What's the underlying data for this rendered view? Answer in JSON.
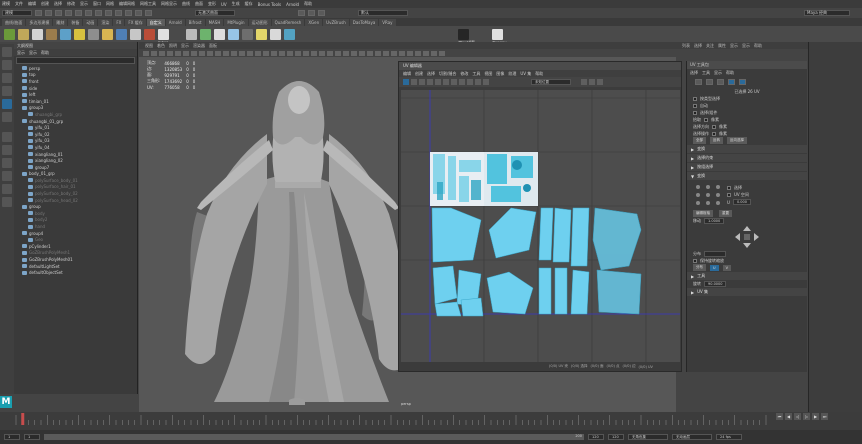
{
  "menubar": {
    "items": [
      "建模",
      "文件",
      "编辑",
      "创建",
      "选择",
      "修改",
      "显示",
      "窗口",
      "网格",
      "编辑网格",
      "网格工具",
      "网格显示",
      "曲线",
      "曲面",
      "变形",
      "UV",
      "生成",
      "缓存",
      "Bonus Tools",
      "Arnold",
      "帮助"
    ],
    "right_label": "Maya 经典"
  },
  "status": {
    "mode": "建模",
    "snap_field": "无激活曲面",
    "render_select": "默认"
  },
  "shelf_tabs": [
    "曲线/曲面",
    "多边形建模",
    "雕刻",
    "装备",
    "动画",
    "渲染",
    "FX",
    "FX 缓存",
    "自定义",
    "Arnold",
    "Bifrost",
    "MASH",
    "MtPlugin",
    "运动图形",
    "QuadRemesh",
    "XGen",
    "UvZBrush",
    "DasToMaya",
    "VRay"
  ],
  "shelf_active_tab": "自定义",
  "shelf_labels": {
    "a": "Uvtool",
    "b": "ZBrush模型",
    "c": "ShaderAttributes",
    "d": "Zhangrou"
  },
  "outliner": {
    "title": "大纲视图",
    "menus": [
      "显示",
      "显示",
      "帮助"
    ],
    "rows": [
      {
        "label": "persp",
        "dim": false,
        "indent": 1
      },
      {
        "label": "top",
        "dim": false,
        "indent": 1
      },
      {
        "label": "front",
        "dim": false,
        "indent": 1
      },
      {
        "label": "side",
        "dim": false,
        "indent": 1
      },
      {
        "label": "left",
        "dim": false,
        "indent": 1
      },
      {
        "label": "timian_01",
        "dim": false,
        "indent": 1
      },
      {
        "label": "group3",
        "dim": false,
        "indent": 1
      },
      {
        "label": "shuangbi_grp",
        "dim": true,
        "indent": 2
      },
      {
        "label": "shuangbi_01_grp",
        "dim": false,
        "indent": 1
      },
      {
        "label": "yifu_01",
        "dim": false,
        "indent": 2
      },
      {
        "label": "yifu_02",
        "dim": false,
        "indent": 2
      },
      {
        "label": "yifu_03",
        "dim": false,
        "indent": 2
      },
      {
        "label": "yifu_04",
        "dim": false,
        "indent": 2
      },
      {
        "label": "xiangliang_01",
        "dim": false,
        "indent": 2
      },
      {
        "label": "xiangliang_02",
        "dim": false,
        "indent": 2
      },
      {
        "label": "group7",
        "dim": false,
        "indent": 2
      },
      {
        "label": "body_01_grp",
        "dim": false,
        "indent": 1
      },
      {
        "label": "polySurface_body_01",
        "dim": true,
        "indent": 2
      },
      {
        "label": "polySurface_hair_01",
        "dim": true,
        "indent": 2
      },
      {
        "label": "polySurface_body_02",
        "dim": true,
        "indent": 2
      },
      {
        "label": "polySurface_head_02",
        "dim": true,
        "indent": 2
      },
      {
        "label": "group",
        "dim": false,
        "indent": 1
      },
      {
        "label": "body",
        "dim": true,
        "indent": 2
      },
      {
        "label": "body2",
        "dim": true,
        "indent": 2
      },
      {
        "label": "hand",
        "dim": true,
        "indent": 2
      },
      {
        "label": "group4",
        "dim": false,
        "indent": 1
      },
      {
        "label": "Geo",
        "dim": true,
        "indent": 2
      },
      {
        "label": "pCylinder1",
        "dim": false,
        "indent": 1
      },
      {
        "label": "GoZBrushPolyMesh1",
        "dim": true,
        "indent": 1
      },
      {
        "label": "GoZBrushPolyMesh01",
        "dim": false,
        "indent": 1
      },
      {
        "label": "defaultLightSet",
        "dim": false,
        "indent": 1
      },
      {
        "label": "defaultObjectSet",
        "dim": false,
        "indent": 1
      }
    ]
  },
  "viewport": {
    "menus": [
      "视图",
      "着色",
      "照明",
      "显示",
      "渲染器",
      "面板"
    ],
    "hud": [
      [
        "顶点:",
        "466868",
        "0",
        "0"
      ],
      [
        "边:",
        "1320853",
        "0",
        "0"
      ],
      [
        "面:",
        "929791",
        "0",
        "0"
      ],
      [
        "三角形:",
        "1743692",
        "0",
        "0"
      ],
      [
        "UV:",
        "776058",
        "0",
        "0"
      ]
    ],
    "camera_label": "persp"
  },
  "main_menu_right": [
    "列表",
    "选择",
    "关注",
    "属性",
    "显示",
    "显示",
    "帮助"
  ],
  "uv_editor": {
    "title": "UV 编辑器",
    "menus": [
      "编辑",
      "创建",
      "选择",
      "切割/缝合",
      "修改",
      "工具",
      "视图",
      "图像",
      "纹理",
      "UV 集",
      "帮助"
    ],
    "field": "未知位置",
    "status_items": [
      "(0/0) UV 壳",
      "(0/0) 选择",
      "(0/0) 面",
      "(0/0) 点",
      "(0/0) 边",
      "(0/0) UV"
    ]
  },
  "uv_toolkit": {
    "title": "UV 工具包",
    "menus": [
      "选择",
      "工具",
      "显示",
      "帮助"
    ],
    "count": "已选择 26 UV",
    "rows": [
      "按类型选择",
      "自动",
      "选择/组件"
    ],
    "pick_label": "拾取",
    "pick_value": "像素",
    "dir_label": "选择方向",
    "dir_value": "像素",
    "sel_label": "选择操作",
    "sel_value": "像素",
    "buttons": [
      "全部",
      "反转",
      "反向选择"
    ],
    "sections": [
      "变换",
      "选择约束",
      "按组选择"
    ],
    "transform_title": "变换",
    "pivot": [
      "选择",
      "UV 空间"
    ],
    "u_label": "U",
    "u_val": "0.000",
    "v_label": "V",
    "v_val": "0.000",
    "edit_pivot": "编辑枢轴",
    "reset": "重置",
    "move_label": "移动",
    "move_val": "1.0000",
    "distribute": "分布",
    "dist_btns": [
      "分布",
      "U",
      "V"
    ],
    "keep_label": "保持旋转缩放",
    "rotate_section": "工具",
    "rotate_label": "旋转",
    "rotate_val": "90.0000",
    "bottom_section": "UV 集"
  },
  "timeslider": {
    "ticks": [
      "0",
      "5",
      "10",
      "15",
      "20",
      "25",
      "30",
      "35",
      "40",
      "45",
      "50",
      "55",
      "60",
      "65",
      "70",
      "75",
      "80",
      "85",
      "90",
      "95",
      "100",
      "105",
      "110",
      "115",
      "120"
    ],
    "start": "1",
    "end": "120",
    "range_start": "1",
    "range_end": "120",
    "anim_end": "200",
    "current": "1",
    "no_char": "无角色集",
    "no_anim": "无动画层",
    "fps": "24 fps"
  }
}
